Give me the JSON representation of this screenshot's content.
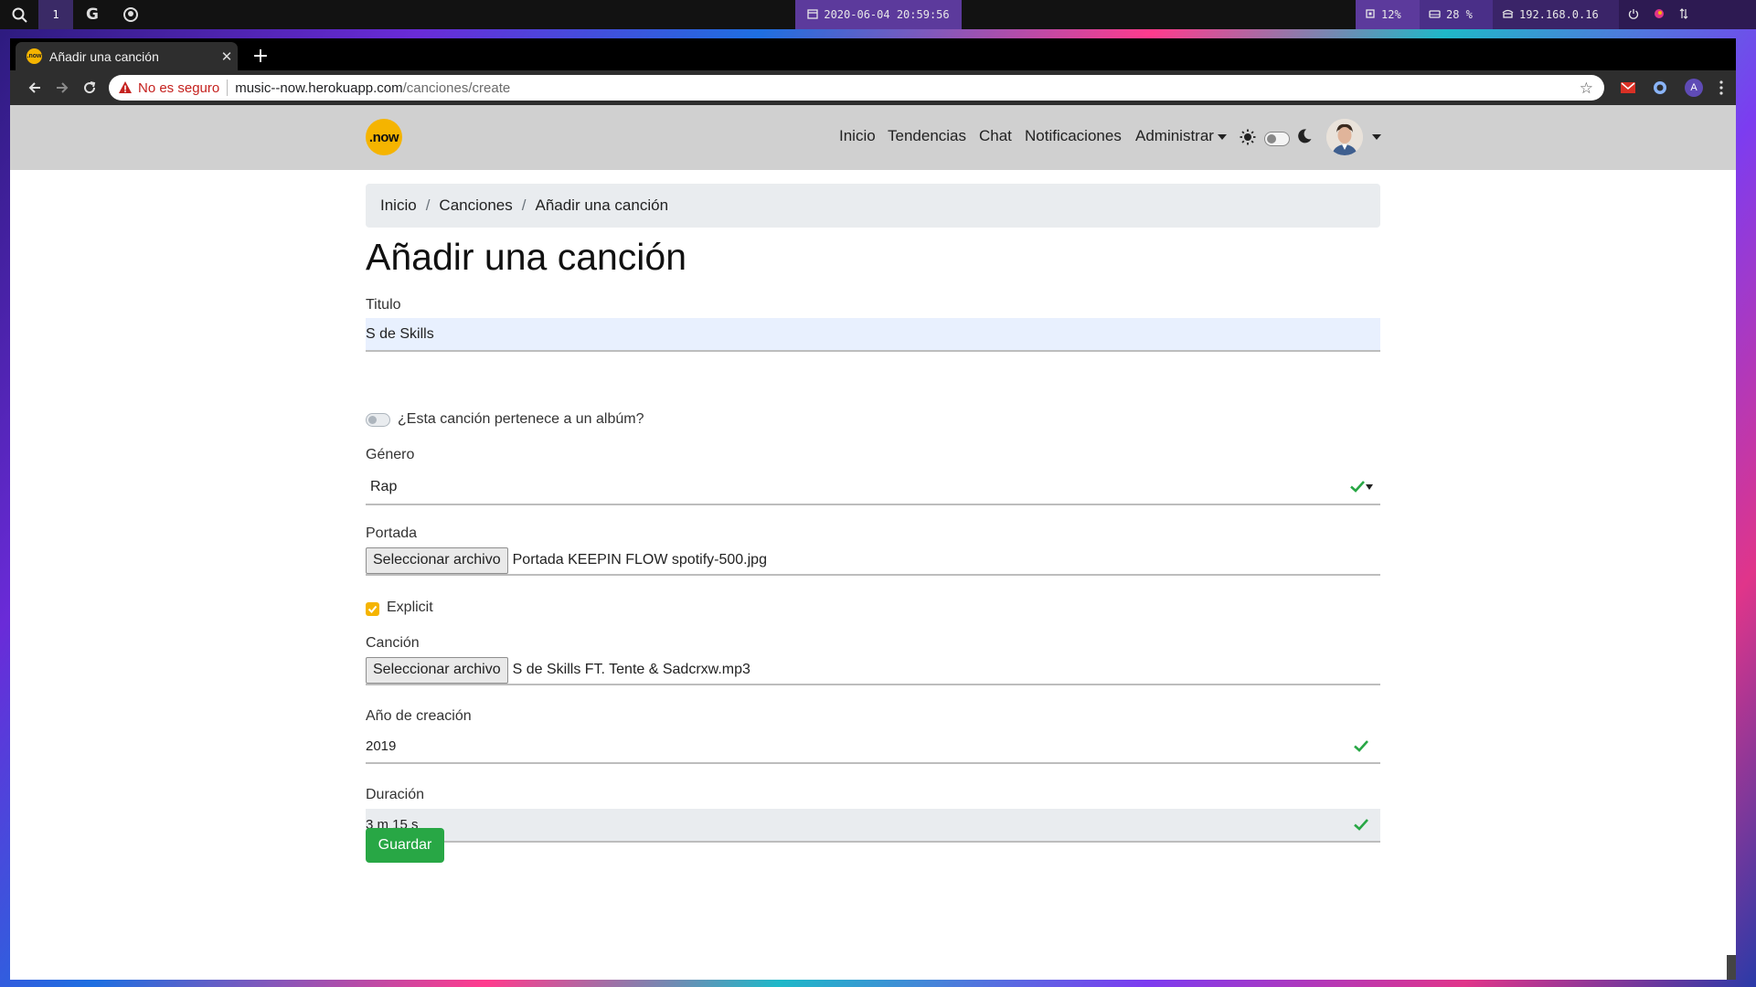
{
  "system_bar": {
    "workspace": "1",
    "google_label": "G",
    "datetime": "2020-06-04 20:59:56",
    "cpu": "12%",
    "disk": "28 %",
    "ip": "192.168.0.16"
  },
  "browser": {
    "tab_title": "Añadir una canción",
    "tab_favicon_text": ".now",
    "insecure_label": "No es seguro",
    "url_host": "music--now.herokuapp.com",
    "url_path": "/canciones/create",
    "profile_initial": "A"
  },
  "navbar": {
    "logo_text": ".now",
    "links": [
      "Inicio",
      "Tendencias",
      "Chat",
      "Notificaciones"
    ],
    "admin_label": "Administrar"
  },
  "breadcrumb": [
    "Inicio",
    "Canciones",
    "Añadir una canción"
  ],
  "page_title": "Añadir una canción",
  "form": {
    "title_label": "Titulo",
    "title_value": "S de Skills",
    "album_switch_label": "¿Esta canción pertenece a un albúm?",
    "genre_label": "Género",
    "genre_value": "Rap",
    "cover_label": "Portada",
    "file_button_label": "Seleccionar archivo",
    "cover_file": "Portada KEEPIN FLOW spotify-500.jpg",
    "explicit_label": "Explicit",
    "song_label": "Canción",
    "song_file": "S de Skills FT. Tente & Sadcrxw.mp3",
    "year_label": "Año de creación",
    "year_value": "2019",
    "duration_label": "Duración",
    "duration_value": "3 m 15 s",
    "save_label": "Guardar"
  },
  "colors": {
    "accent_yellow": "#f5b400",
    "success_green": "#28a745",
    "navbar_bg": "#d0d0d0",
    "insecure_red": "#c5221f"
  }
}
